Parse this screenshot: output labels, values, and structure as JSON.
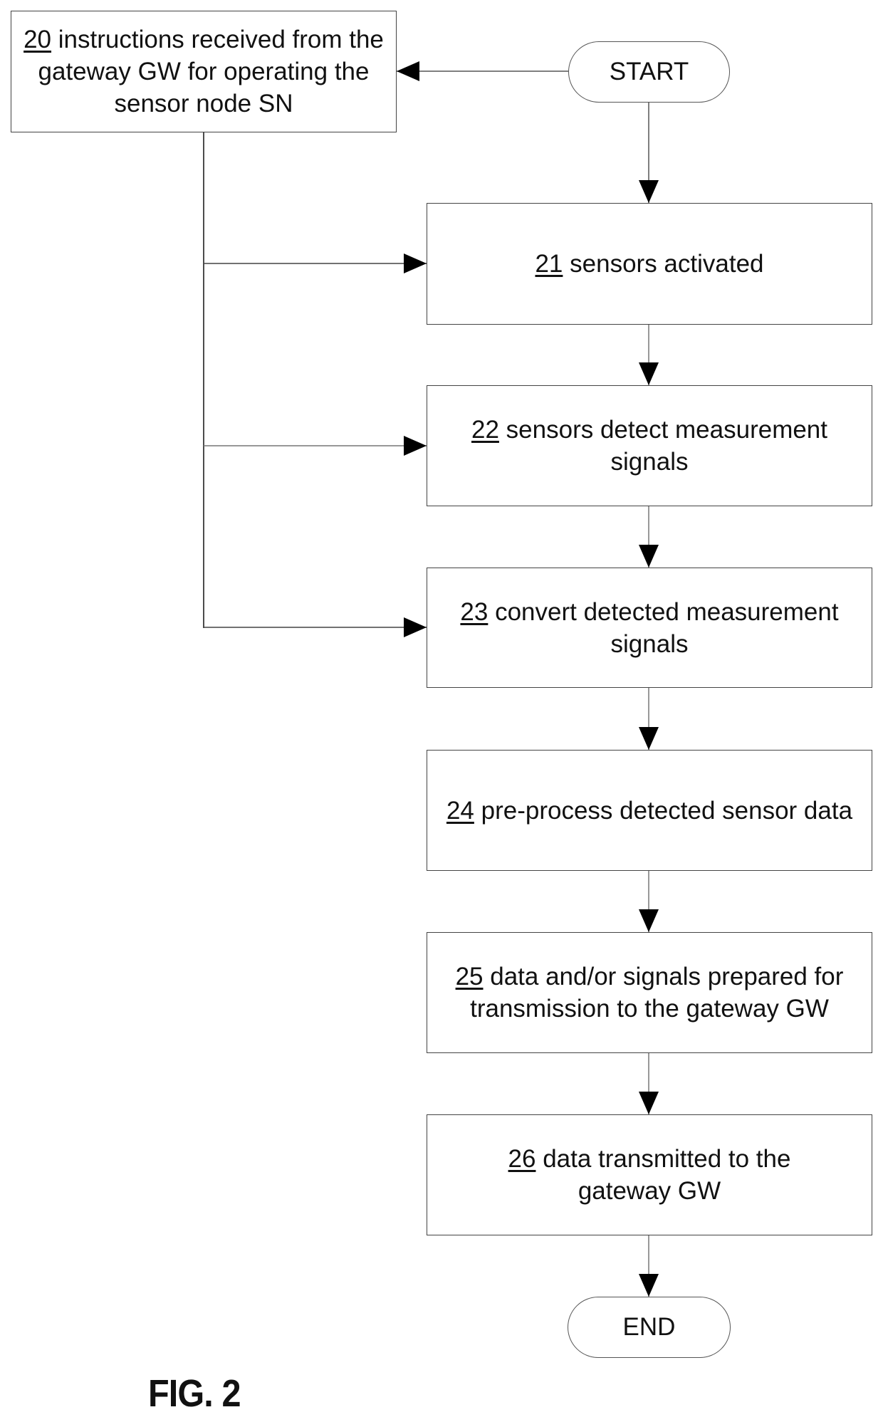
{
  "figure_label": "FIG. 2",
  "terminals": {
    "start": "START",
    "end": "END"
  },
  "steps": [
    {
      "num": "20",
      "text": "instructions received from the gateway GW for operating the sensor node SN"
    },
    {
      "num": "21",
      "text": "sensors activated"
    },
    {
      "num": "22",
      "text": "sensors detect measurement signals"
    },
    {
      "num": "23",
      "text": "convert detected measurement signals"
    },
    {
      "num": "24",
      "text": "pre-process detected sensor data"
    },
    {
      "num": "25",
      "text": "data and/or signals prepared for transmission to the gateway GW"
    },
    {
      "num": "26",
      "text": "data transmitted to the gateway GW"
    }
  ],
  "connections": [
    {
      "from": "START",
      "to": "20"
    },
    {
      "from": "START",
      "to": "21"
    },
    {
      "from": "20",
      "to": "21"
    },
    {
      "from": "20",
      "to": "22"
    },
    {
      "from": "20",
      "to": "23"
    },
    {
      "from": "21",
      "to": "22"
    },
    {
      "from": "22",
      "to": "23"
    },
    {
      "from": "23",
      "to": "24"
    },
    {
      "from": "24",
      "to": "25"
    },
    {
      "from": "25",
      "to": "26"
    },
    {
      "from": "26",
      "to": "END"
    }
  ]
}
